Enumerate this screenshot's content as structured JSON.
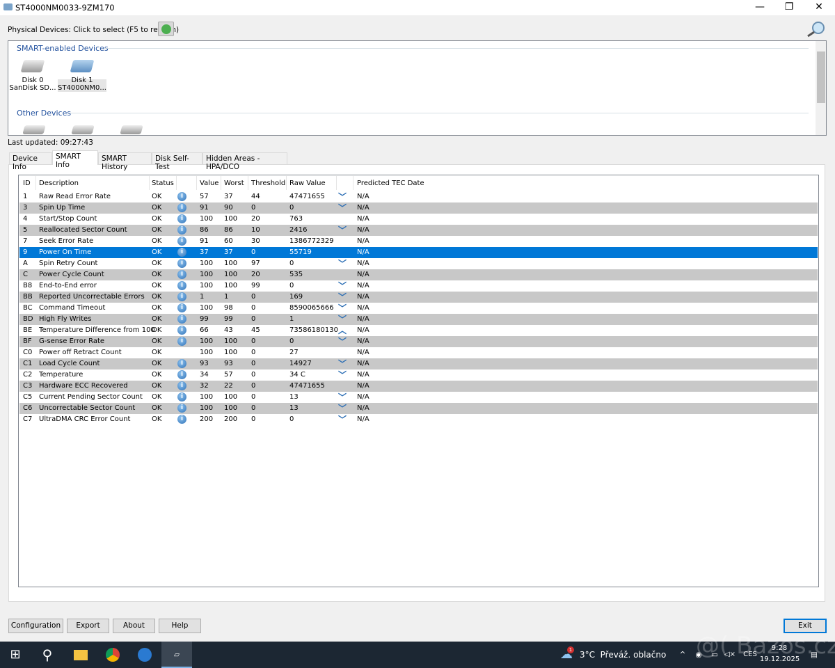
{
  "window": {
    "title": "ST4000NM0033-9ZM170",
    "min": "—",
    "max": "❐",
    "close": "✕"
  },
  "toolbar": {
    "physical_label": "Physical Devices: Click to select (F5 to refresh)"
  },
  "devices": {
    "smart_group": "SMART-enabled Devices",
    "other_group": "Other Devices",
    "smart": [
      {
        "name": "Disk 0",
        "model": "SanDisk SD..."
      },
      {
        "name": "Disk 1",
        "model": "ST4000NM0..."
      }
    ]
  },
  "last_updated": "Last updated: 09:27:43",
  "tabs": [
    {
      "label": "Device Info"
    },
    {
      "label": "SMART Info",
      "active": true
    },
    {
      "label": "SMART History"
    },
    {
      "label": "Disk Self-Test"
    },
    {
      "label": "Hidden Areas - HPA/DCO"
    }
  ],
  "table": {
    "headers": {
      "id": "ID",
      "desc": "Description",
      "status": "Status",
      "value": "Value",
      "worst": "Worst",
      "threshold": "Threshold",
      "raw": "Raw Value",
      "tec": "Predicted TEC Date"
    },
    "rows": [
      [
        "1",
        "Raw Read Error Rate",
        "OK",
        true,
        "57",
        "37",
        "44",
        "47471655",
        "down",
        "N/A"
      ],
      [
        "3",
        "Spin Up Time",
        "OK",
        true,
        "91",
        "90",
        "0",
        "0",
        "down",
        "N/A"
      ],
      [
        "4",
        "Start/Stop Count",
        "OK",
        true,
        "100",
        "100",
        "20",
        "763",
        "",
        "N/A"
      ],
      [
        "5",
        "Reallocated Sector Count",
        "OK",
        true,
        "86",
        "86",
        "10",
        "2416",
        "down",
        "N/A"
      ],
      [
        "7",
        "Seek Error Rate",
        "OK",
        true,
        "91",
        "60",
        "30",
        "1386772329",
        "",
        "N/A"
      ],
      [
        "9",
        "Power On Time",
        "OK",
        true,
        "37",
        "37",
        "0",
        "55719",
        "",
        "N/A"
      ],
      [
        "A",
        "Spin Retry Count",
        "OK",
        true,
        "100",
        "100",
        "97",
        "0",
        "down",
        "N/A"
      ],
      [
        "C",
        "Power Cycle Count",
        "OK",
        true,
        "100",
        "100",
        "20",
        "535",
        "",
        "N/A"
      ],
      [
        "B8",
        "End-to-End error",
        "OK",
        true,
        "100",
        "100",
        "99",
        "0",
        "down",
        "N/A"
      ],
      [
        "BB",
        "Reported Uncorrectable Errors",
        "OK",
        true,
        "1",
        "1",
        "0",
        "169",
        "down",
        "N/A"
      ],
      [
        "BC",
        "Command Timeout",
        "OK",
        true,
        "100",
        "98",
        "0",
        "8590065666",
        "down",
        "N/A"
      ],
      [
        "BD",
        "High Fly Writes",
        "OK",
        true,
        "99",
        "99",
        "0",
        "1",
        "down",
        "N/A"
      ],
      [
        "BE",
        "Temperature Difference from 100",
        "OK",
        true,
        "66",
        "43",
        "45",
        "73586180130",
        "up",
        "N/A"
      ],
      [
        "BF",
        "G-sense Error Rate",
        "OK",
        true,
        "100",
        "100",
        "0",
        "0",
        "down",
        "N/A"
      ],
      [
        "C0",
        "Power off Retract Count",
        "OK",
        false,
        "100",
        "100",
        "0",
        "27",
        "",
        "N/A"
      ],
      [
        "C1",
        "Load Cycle Count",
        "OK",
        true,
        "93",
        "93",
        "0",
        "14927",
        "down",
        "N/A"
      ],
      [
        "C2",
        "Temperature",
        "OK",
        true,
        "34",
        "57",
        "0",
        "34 C",
        "down",
        "N/A"
      ],
      [
        "C3",
        "Hardware ECC Recovered",
        "OK",
        true,
        "32",
        "22",
        "0",
        "47471655",
        "",
        "N/A"
      ],
      [
        "C5",
        "Current Pending Sector Count",
        "OK",
        true,
        "100",
        "100",
        "0",
        "13",
        "down",
        "N/A"
      ],
      [
        "C6",
        "Uncorrectable Sector Count",
        "OK",
        true,
        "100",
        "100",
        "0",
        "13",
        "down",
        "N/A"
      ],
      [
        "C7",
        "UltraDMA CRC Error Count",
        "OK",
        true,
        "200",
        "200",
        "0",
        "0",
        "down",
        "N/A"
      ]
    ],
    "selected_row": 5
  },
  "buttons": {
    "configuration": "Configuration",
    "export": "Export",
    "about": "About",
    "help": "Help",
    "exit": "Exit"
  },
  "taskbar": {
    "weather": "3°C  Převáž. oblačno",
    "weather_badge": "1",
    "lang": "CES",
    "time": "9:28",
    "date": "19.12.2025",
    "watermark": "@( Bazos.cz"
  },
  "colors": {
    "selection": "#0078d7",
    "alt_row": "#c8c8c8",
    "group_header": "#1e4e9c"
  }
}
